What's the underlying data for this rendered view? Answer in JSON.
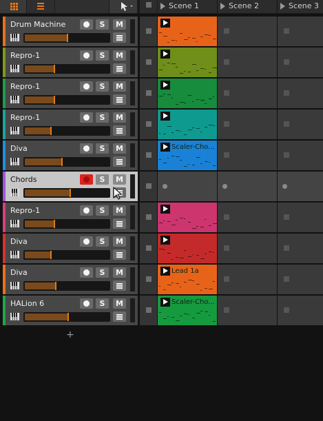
{
  "header": {
    "scenes": [
      {
        "label": "Scene 1"
      },
      {
        "label": "Scene 2"
      },
      {
        "label": "Scene 3"
      }
    ],
    "add_track_label": "+"
  },
  "buttons": {
    "rec_icon": "record-dot-icon",
    "solo": "S",
    "mute": "M"
  },
  "tracks": [
    {
      "name": "Drum Machine",
      "color": "#e8711c",
      "meter": 0.51,
      "armed": false,
      "selected": false,
      "clip": {
        "color": "#e8631a",
        "name": ""
      }
    },
    {
      "name": "Repro-1",
      "color": "#7d9a1e",
      "meter": 0.35,
      "armed": false,
      "selected": false,
      "clip": {
        "color": "#6f8e1a",
        "name": ""
      }
    },
    {
      "name": "Repro-1",
      "color": "#1e9e4a",
      "meter": 0.35,
      "armed": false,
      "selected": false,
      "clip": {
        "color": "#168c3c",
        "name": ""
      }
    },
    {
      "name": "Repro-1",
      "color": "#18a69a",
      "meter": 0.31,
      "armed": false,
      "selected": false,
      "clip": {
        "color": "#0f9a90",
        "name": ""
      }
    },
    {
      "name": "Diva",
      "color": "#1f8ee0",
      "meter": 0.44,
      "armed": false,
      "selected": false,
      "clip": {
        "color": "#1a82d6",
        "name": "Scaler-Cho..."
      }
    },
    {
      "name": "Chords",
      "color": "#9a57d6",
      "meter": 0.54,
      "armed": true,
      "selected": true,
      "clip": null
    },
    {
      "name": "Repro-1",
      "color": "#d8407a",
      "meter": 0.35,
      "armed": false,
      "selected": false,
      "clip": {
        "color": "#cc356e",
        "name": ""
      }
    },
    {
      "name": "Diva",
      "color": "#d83030",
      "meter": 0.31,
      "armed": false,
      "selected": false,
      "clip": {
        "color": "#c52a2a",
        "name": ""
      }
    },
    {
      "name": "Diva",
      "color": "#e8711c",
      "meter": 0.37,
      "armed": false,
      "selected": false,
      "clip": {
        "color": "#e8631a",
        "name": "Lead 1a"
      }
    },
    {
      "name": "HALion 6",
      "color": "#1ea84a",
      "meter": 0.52,
      "armed": false,
      "selected": false,
      "clip": {
        "color": "#169a40",
        "name": "Scaler-Cho..."
      }
    }
  ]
}
